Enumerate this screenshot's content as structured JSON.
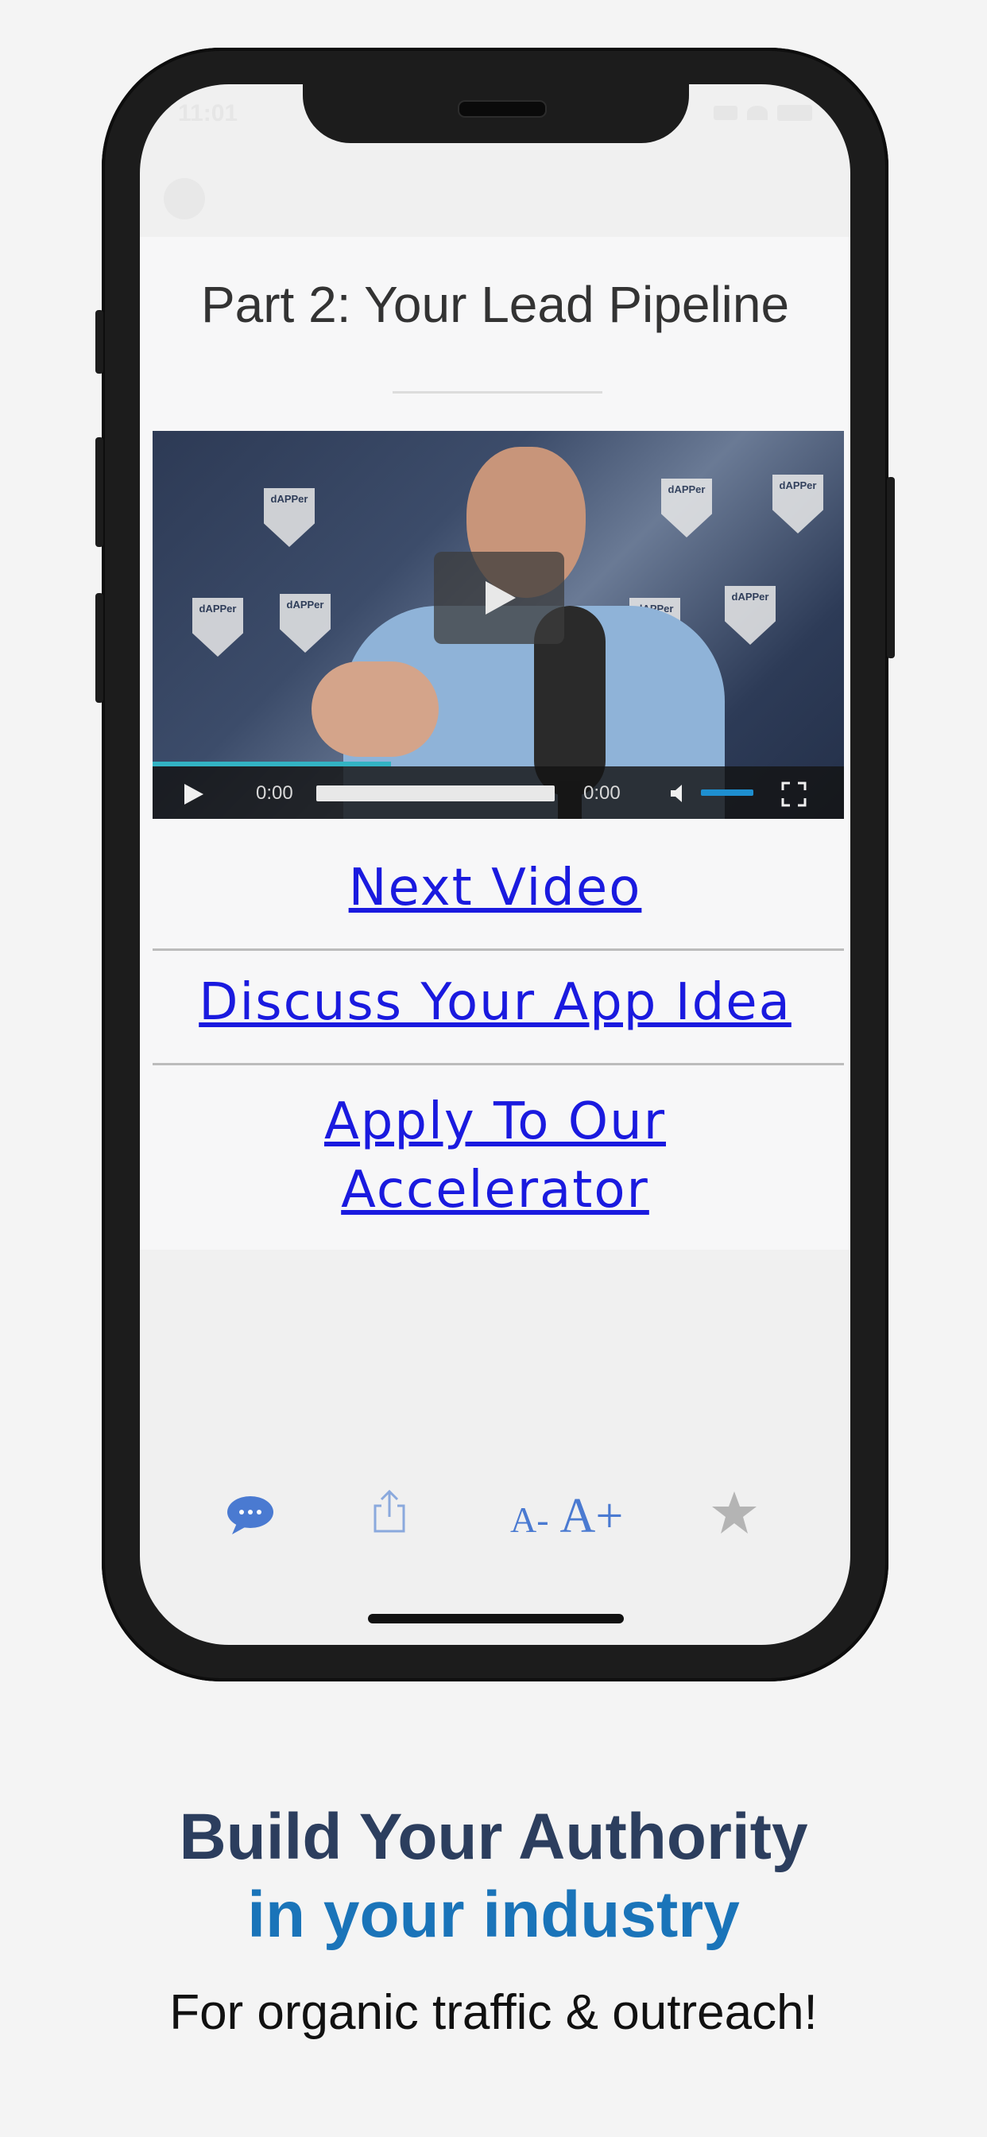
{
  "status_bar": {
    "time": "11:01"
  },
  "page": {
    "title": "Part 2: Your Lead Pipeline"
  },
  "video": {
    "current_time": "0:00",
    "duration": "0:00",
    "backdrop_logo_text": "dAPPer"
  },
  "links": {
    "next_video": "Next Video",
    "discuss": "Discuss Your App Idea",
    "apply_line1": "Apply To Our",
    "apply_line2": "Accelerator"
  },
  "toolbar": {
    "items": [
      {
        "name": "chat-bubble-icon",
        "label": ""
      },
      {
        "name": "share-icon",
        "label": ""
      },
      {
        "name": "font-size-icon",
        "label": "A- A+"
      },
      {
        "name": "star-icon",
        "label": ""
      }
    ],
    "font_decrease": "A-",
    "font_increase": "A+"
  },
  "marketing": {
    "headline_line1": "Build Your Authority",
    "headline_line2": "in your industry",
    "subline": "For organic traffic & outreach!"
  },
  "colors": {
    "background": "#f4f4f4",
    "link": "#1a1adf",
    "headline_dark": "#2c3e5e",
    "headline_blue": "#1a74b9",
    "toolbar_icon": "#4a7ad1",
    "volume_fill": "#1e8fd0"
  }
}
